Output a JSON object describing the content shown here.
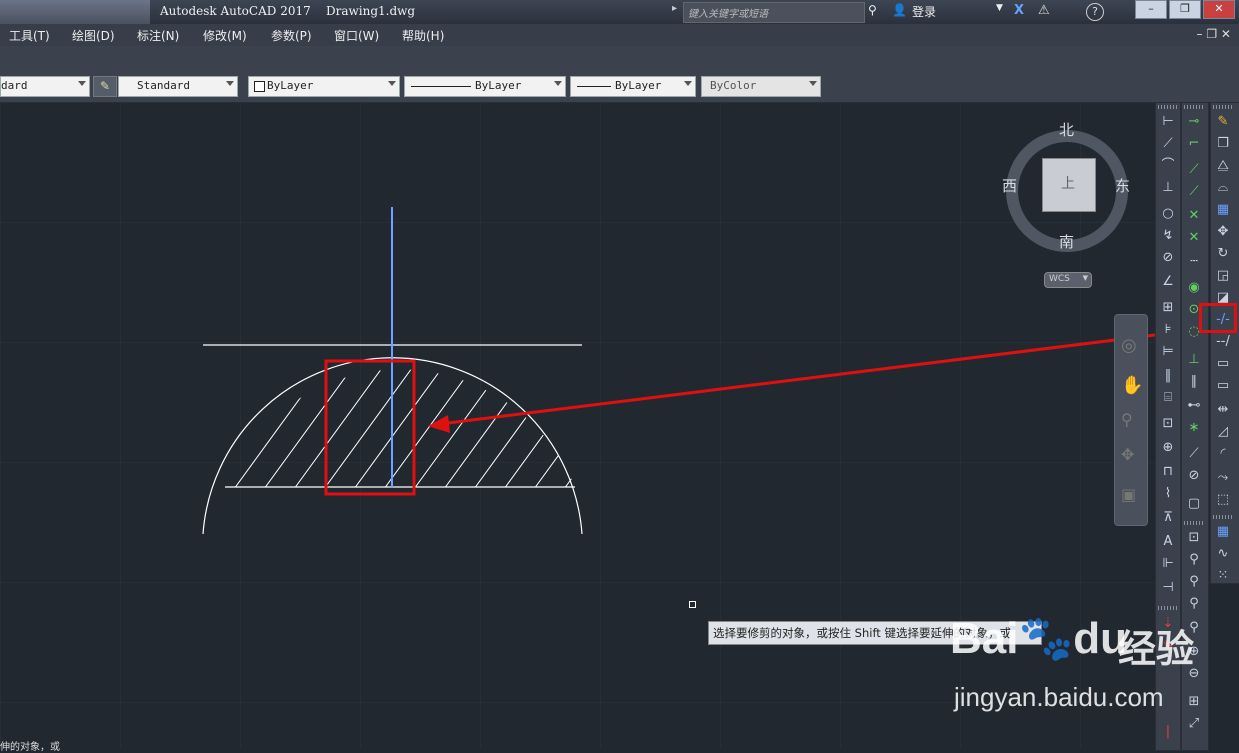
{
  "window": {
    "title": "Autodesk AutoCAD 2017    Drawing1.dwg",
    "search_placeholder": "键入关键字或短语",
    "login_label": "登录",
    "help_label": "?",
    "controls": [
      "–",
      "❐",
      "✕"
    ]
  },
  "menubar": {
    "items": [
      "工具(T)",
      "绘图(D)",
      "标注(N)",
      "修改(M)",
      "参数(P)",
      "窗口(W)",
      "帮助(H)"
    ],
    "mdi_controls": "– ❐ ✕"
  },
  "properties_toolbar": {
    "text_style": "dard",
    "dim_style": "Standard",
    "layer_color": "ByLayer",
    "linetype": "ByLayer",
    "lineweight": "ByLayer",
    "plot_style": "ByColor"
  },
  "viewcube": {
    "north": "北",
    "south": "南",
    "east": "东",
    "west": "西",
    "top_face": "上",
    "ucs_label": "WCS"
  },
  "tooltip": {
    "text": "选择要修剪的对象，或按住 Shift 键选择要延伸的对象，或"
  },
  "command_line": {
    "text": "伸的对象，或"
  },
  "watermark": {
    "brand_part1": "Bai",
    "brand_part2": "du",
    "cn_label": "经验",
    "url": "jingyan.baidu.com"
  },
  "colors": {
    "canvas_bg": "#212830",
    "annotation_red": "#e01010",
    "selected_line_blue": "#6aa4ff",
    "drawing_white": "#ffffff"
  },
  "highlighted_tool": "trim-icon"
}
